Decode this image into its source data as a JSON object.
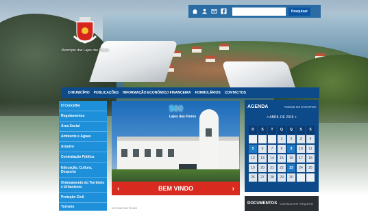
{
  "topbar": {
    "icons": [
      "home-icon",
      "user-icon",
      "mail-icon",
      "facebook-icon"
    ],
    "search_placeholder": "",
    "search_button": "Pesquisar"
  },
  "logo": {
    "caption": "Município das Lajes das Flores"
  },
  "main_nav": {
    "items": [
      "O MUNICÍPIO",
      "PUBLICAÇÕES",
      "INFORMAÇÃO ECONÓMICO FINANCEIRA",
      "FORMULÁRIOS",
      "CONTACTOS"
    ]
  },
  "sidebar": {
    "items": [
      "O Concelho",
      "Regulamentos",
      "Área Social",
      "Ambiente e Águas",
      "Arquivo",
      "Contratação Pública",
      "Educação, Cultura, Desporto",
      "Ordenamento do Território e Urbanismo",
      "Proteção Civil",
      "Turismo"
    ]
  },
  "slideshow": {
    "logo_text": "500",
    "logo_sub": "Lajes das Flores",
    "title": "BEM VINDO",
    "prev": "‹",
    "next": "›",
    "below_text": "ÚLTIMAS NOTÍCIAS"
  },
  "agenda": {
    "title": "AGENDA",
    "all_events": "TODOS OS EVENTOS",
    "month_label": "< ABRIL DE 2015 >",
    "day_headers": [
      "D",
      "S",
      "T",
      "Q",
      "Q",
      "S",
      "S"
    ],
    "days": [
      "",
      "",
      "",
      "1",
      "2",
      "3",
      "4",
      "5",
      "6",
      "7",
      "8",
      "9",
      "10",
      "11",
      "12",
      "13",
      "14",
      "15",
      "16",
      "17",
      "18",
      "19",
      "20",
      "21",
      "22",
      "23",
      "24",
      "25",
      "26",
      "27",
      "28",
      "29",
      "30",
      "",
      ""
    ],
    "highlighted": [
      "5",
      "9",
      "23"
    ]
  },
  "documents": {
    "title": "DOCUMENTOS",
    "link": "CONSULTAR ARQUIVO"
  },
  "colors": {
    "nav_blue": "#0d4a8a",
    "sidebar_blue": "#1e8fd9",
    "accent_red": "#d82a1e"
  }
}
